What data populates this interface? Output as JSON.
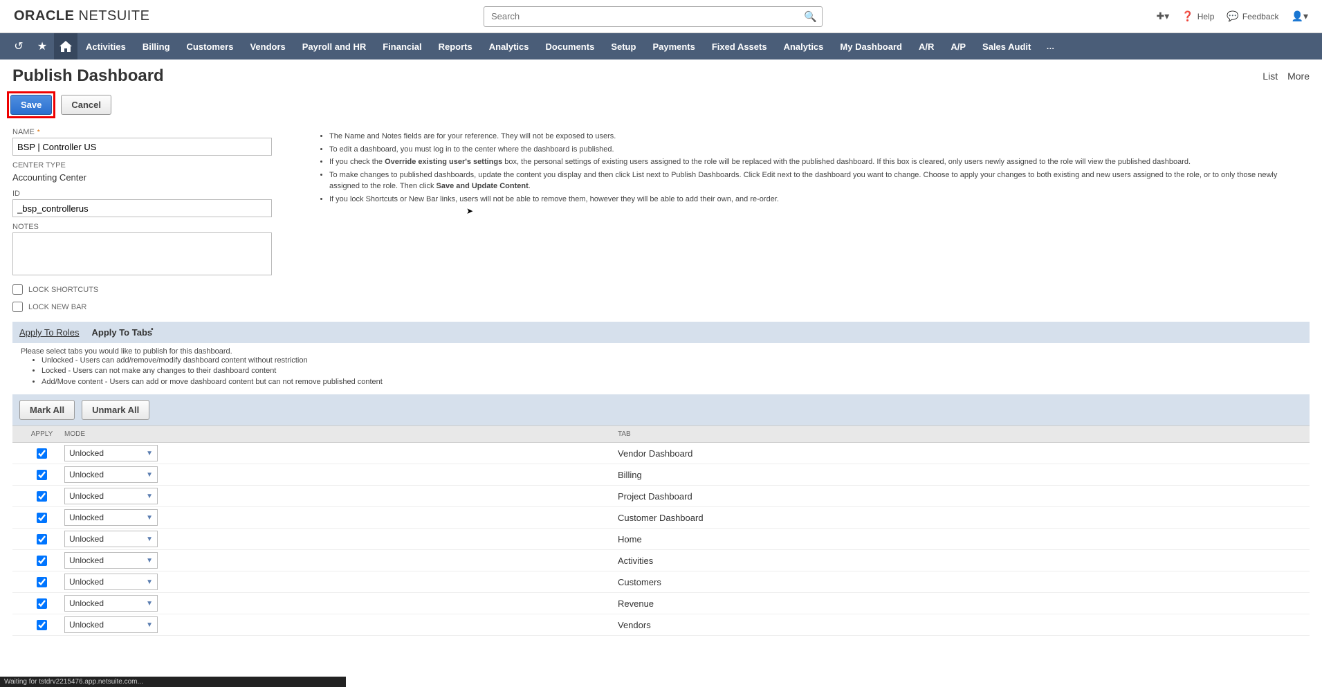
{
  "logo": {
    "part1": "ORACLE",
    "part2": "NETSUITE"
  },
  "search": {
    "placeholder": "Search"
  },
  "topright": {
    "help": "Help",
    "feedback": "Feedback"
  },
  "nav": [
    "Activities",
    "Billing",
    "Customers",
    "Vendors",
    "Payroll and HR",
    "Financial",
    "Reports",
    "Analytics",
    "Documents",
    "Setup",
    "Payments",
    "Fixed Assets",
    "Analytics",
    "My Dashboard",
    "A/R",
    "A/P",
    "Sales Audit"
  ],
  "page": {
    "title": "Publish Dashboard",
    "right_list": "List",
    "right_more": "More"
  },
  "buttons": {
    "save": "Save",
    "cancel": "Cancel",
    "markall": "Mark All",
    "unmarkall": "Unmark All"
  },
  "form": {
    "name_label": "NAME",
    "name_value": "BSP | Controller US",
    "centertype_label": "CENTER TYPE",
    "centertype_value": "Accounting Center",
    "id_label": "ID",
    "id_value": "_bsp_controllerus",
    "notes_label": "NOTES",
    "notes_value": "",
    "lock_shortcuts": "LOCK SHORTCUTS",
    "lock_newbar": "LOCK NEW BAR"
  },
  "info": {
    "l1": "The Name and Notes fields are for your reference. They will not be exposed to users.",
    "l2": "To edit a dashboard, you must log in to the center where the dashboard is published.",
    "l3a": "If you check the ",
    "l3b": "Override existing user's settings",
    "l3c": " box, the personal settings of existing users assigned to the role will be replaced with the published dashboard. If this box is cleared, only users newly assigned to the role will view the published dashboard.",
    "l4a": "To make changes to published dashboards, update the content you display and then click List next to Publish Dashboards. Click Edit next to the dashboard you want to change. Choose to apply your changes to both existing and new users assigned to the role, or to only those newly assigned to the role. Then click ",
    "l4b": "Save and Update Content",
    "l4c": ".",
    "l5": "If you lock Shortcuts or New Bar links, users will not be able to remove them, however they will be able to add their own, and re-order."
  },
  "tabs": {
    "roles": "Apply To Roles",
    "tabs": "Apply To Tabs",
    "dot": "•",
    "text0": "Please select tabs you would like to publish for this dashboard.",
    "text1": "Unlocked - Users can add/remove/modify dashboard content without restriction",
    "text2": "Locked - Users can not make any changes to their dashboard content",
    "text3": "Add/Move content - Users can add or move dashboard content but can not remove published content"
  },
  "table": {
    "header": {
      "apply": "APPLY",
      "mode": "MODE",
      "tab": "TAB"
    },
    "mode_default": "Unlocked",
    "rows": [
      {
        "apply": true,
        "mode": "Unlocked",
        "tab": "Vendor Dashboard"
      },
      {
        "apply": true,
        "mode": "Unlocked",
        "tab": "Billing"
      },
      {
        "apply": true,
        "mode": "Unlocked",
        "tab": "Project Dashboard"
      },
      {
        "apply": true,
        "mode": "Unlocked",
        "tab": "Customer Dashboard"
      },
      {
        "apply": true,
        "mode": "Unlocked",
        "tab": "Home"
      },
      {
        "apply": true,
        "mode": "Unlocked",
        "tab": "Activities"
      },
      {
        "apply": true,
        "mode": "Unlocked",
        "tab": "Customers"
      },
      {
        "apply": true,
        "mode": "Unlocked",
        "tab": "Revenue"
      },
      {
        "apply": true,
        "mode": "Unlocked",
        "tab": "Vendors"
      }
    ]
  },
  "status": "Waiting for tstdrv2215476.app.netsuite.com..."
}
